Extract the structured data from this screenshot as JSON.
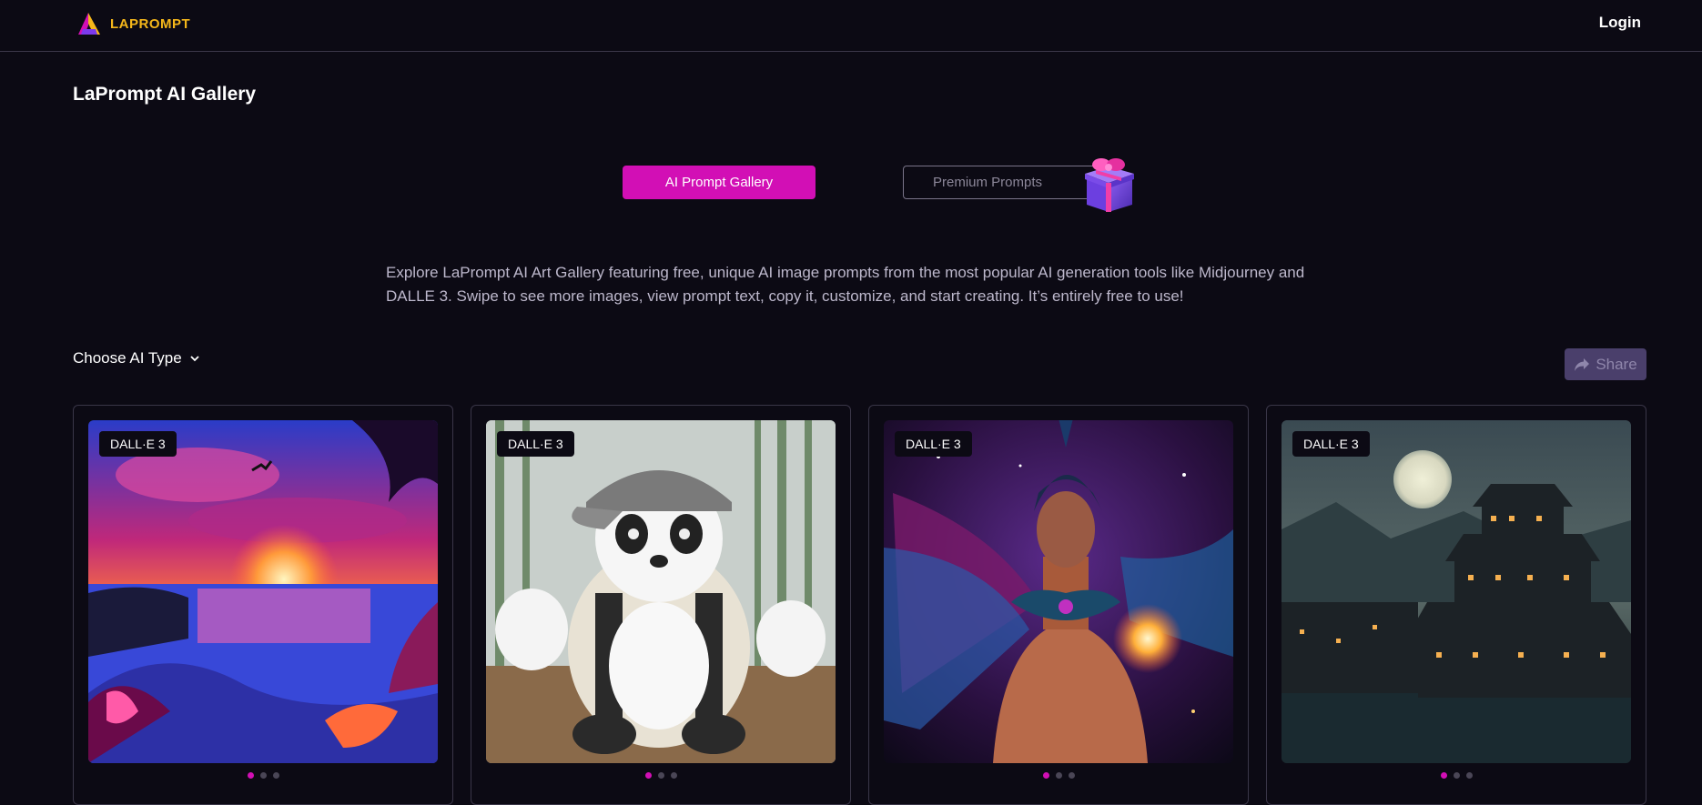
{
  "header": {
    "logo_text": "LAPROMPT",
    "login_label": "Login"
  },
  "page": {
    "title": "LaPrompt AI Gallery",
    "tabs": [
      {
        "label": "AI Prompt Gallery",
        "active": true
      },
      {
        "label": "Premium Prompts",
        "active": false
      }
    ],
    "intro": "Explore LaPrompt AI Art Gallery featuring free, unique AI image prompts from the most popular AI generation tools like Midjourney and DALLE 3. Swipe to see more images, view prompt text, copy it, customize, and start creating. It’s entirely free to use!",
    "filter_label": "Choose AI Type",
    "share_label": "Share"
  },
  "cards": [
    {
      "badge": "DALL·E 3",
      "subject": "tropical sunset beach",
      "dots": 3,
      "active_dot": 0
    },
    {
      "badge": "DALL·E 3",
      "subject": "panda in cap and jacket",
      "dots": 3,
      "active_dot": 0
    },
    {
      "badge": "DALL·E 3",
      "subject": "winged warrior with glowing orb",
      "dots": 3,
      "active_dot": 0
    },
    {
      "badge": "DALL·E 3",
      "subject": "pagoda village under full moon",
      "dots": 3,
      "active_dot": 0
    }
  ],
  "colors": {
    "background": "#0c0a14",
    "accent": "#d20fb5",
    "logo": "#f5b71a",
    "share_bg": "#4a3f6b"
  }
}
